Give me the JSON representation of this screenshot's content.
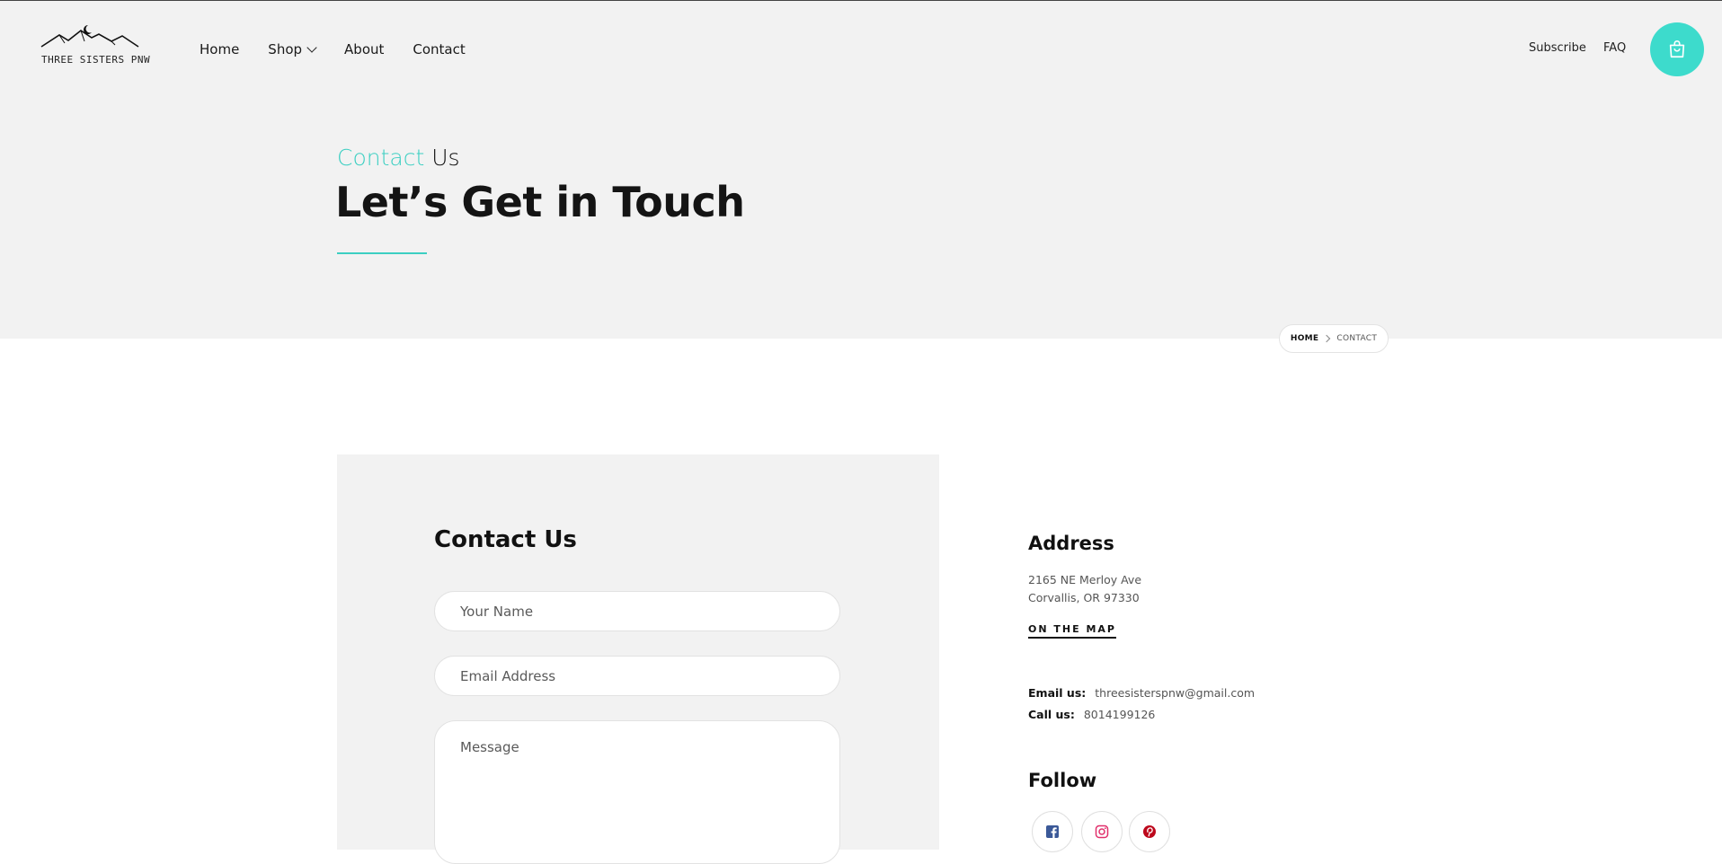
{
  "brand": {
    "logo_text": "THREE SISTERS PNW"
  },
  "nav": {
    "home": "Home",
    "shop": "Shop",
    "about": "About",
    "contact": "Contact"
  },
  "utility": {
    "subscribe": "Subscribe",
    "faq": "FAQ",
    "cart_icon": "shopping-bag-icon"
  },
  "hero": {
    "eyebrow_accent": "Contact",
    "eyebrow_rest": "Us",
    "headline": "Let’s Get in Touch",
    "accent_color": "#3ccfc2"
  },
  "breadcrumb": {
    "home": "HOME",
    "current": "CONTACT"
  },
  "form": {
    "title": "Contact Us",
    "name_placeholder": "Your Name",
    "email_placeholder": "Email Address",
    "message_placeholder": "Message"
  },
  "info": {
    "address_heading": "Address",
    "address_line1": "2165 NE Merloy Ave",
    "address_line2": "Corvallis, OR 97330",
    "map_link": "ON THE MAP",
    "email_label": "Email us:",
    "email_value": "threesisterspnw@gmail.com",
    "call_label": "Call us:",
    "call_value": "8014199126",
    "follow_heading": "Follow",
    "social": [
      "facebook-icon",
      "instagram-icon",
      "pinterest-icon"
    ]
  },
  "colors": {
    "accent": "#3ddbcc",
    "hero_bg": "#f2f2f2",
    "facebook": "#3b5998",
    "instagram": "#e1306c",
    "pinterest": "#bd081c"
  }
}
